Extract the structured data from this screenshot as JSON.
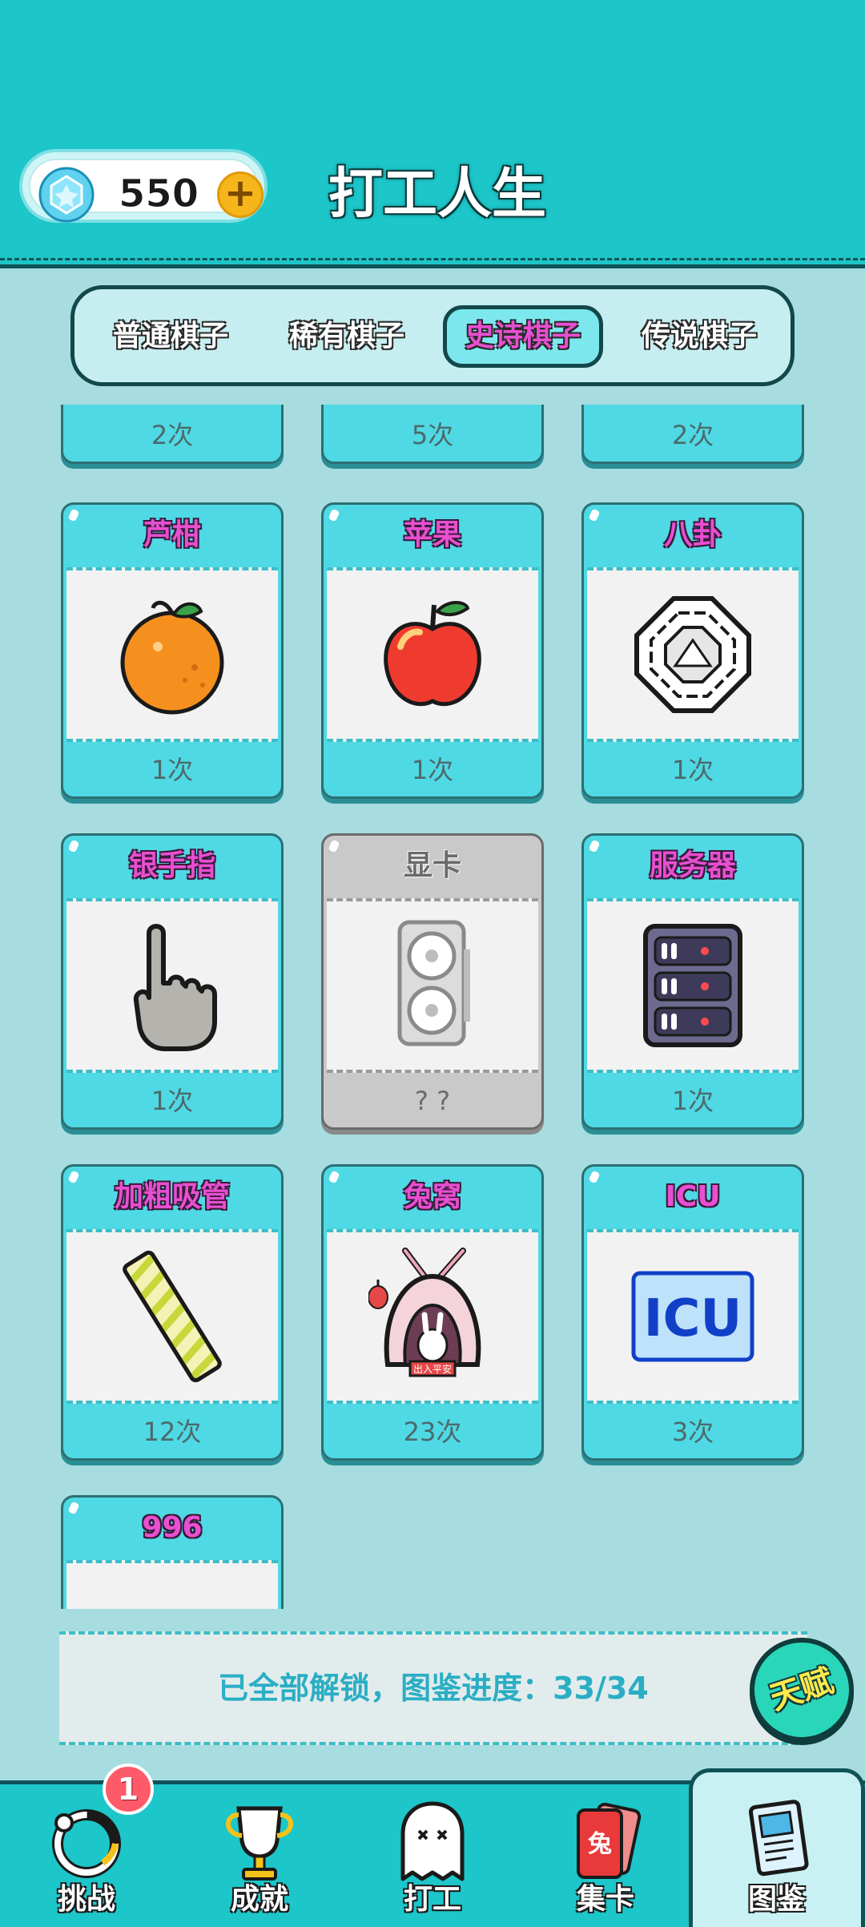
{
  "header": {
    "gem_count": "550",
    "plus_label": "+",
    "title": "打工人生"
  },
  "tabs": [
    {
      "label": "普通棋子",
      "active": false
    },
    {
      "label": "稀有棋子",
      "active": false
    },
    {
      "label": "史诗棋子",
      "active": true
    },
    {
      "label": "传说棋子",
      "active": false
    }
  ],
  "partial_row": [
    {
      "count": "2次"
    },
    {
      "count": "5次"
    },
    {
      "count": "2次"
    }
  ],
  "cards": [
    {
      "title": "芦柑",
      "count": "1次",
      "icon": "tangerine-icon",
      "locked": false
    },
    {
      "title": "苹果",
      "count": "1次",
      "icon": "apple-icon",
      "locked": false
    },
    {
      "title": "八卦",
      "count": "1次",
      "icon": "bagua-icon",
      "locked": false
    },
    {
      "title": "银手指",
      "count": "1次",
      "icon": "pointing-finger-icon",
      "locked": false
    },
    {
      "title": "显卡",
      "count": "? ?",
      "icon": "graphics-card-icon",
      "locked": true
    },
    {
      "title": "服务器",
      "count": "1次",
      "icon": "server-icon",
      "locked": false
    },
    {
      "title": "加粗吸管",
      "count": "12次",
      "icon": "straw-icon",
      "locked": false
    },
    {
      "title": "兔窝",
      "count": "23次",
      "icon": "rabbit-house-icon",
      "locked": false,
      "icon_text": "出入平安"
    },
    {
      "title": "ICU",
      "count": "3次",
      "icon": "icu-sign-icon",
      "locked": false,
      "icon_text": "ICU"
    },
    {
      "title": "996",
      "count": "",
      "icon": "calendar-icon",
      "locked": false
    }
  ],
  "status": {
    "text": "已全部解锁，图鉴进度：33/34"
  },
  "talent_button": {
    "label": "天赋"
  },
  "bottom_nav": [
    {
      "label": "挑战",
      "icon": "challenge-icon",
      "badge": "1"
    },
    {
      "label": "成就",
      "icon": "trophy-icon"
    },
    {
      "label": "打工",
      "icon": "ghost-icon"
    },
    {
      "label": "集卡",
      "icon": "cards-icon",
      "icon_text": "兔"
    },
    {
      "label": "图鉴",
      "icon": "book-icon",
      "active": true
    }
  ],
  "colors": {
    "header_bg": "#1cc6c9",
    "page_bg": "#a7dde0",
    "card_bg": "#4fd9e4",
    "title_pink": "#e84fd1",
    "status_blue": "#2aaec4"
  }
}
